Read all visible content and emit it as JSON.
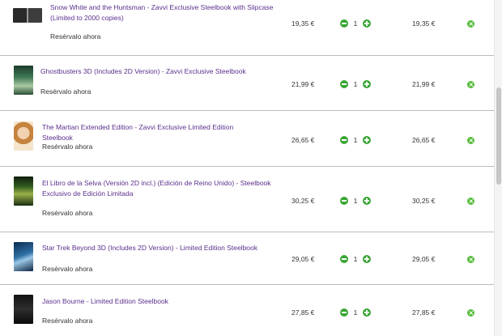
{
  "colors": {
    "title": "#5b2f8c",
    "minus_button": "#3aa635",
    "plus_button": "#3aa635",
    "remove_button": "#55bb3a"
  },
  "icons": {
    "decrease": "minus-circle-icon",
    "increase": "plus-circle-icon",
    "remove": "close-circle-icon"
  },
  "cart": {
    "items": [
      {
        "title": "Snow White and the Huntsman - Zavvi Exclusive Steelbook with Slipcase (Limited to 2000 copies)",
        "status": "Resérvalo ahora",
        "unit_price": "19,35 €",
        "quantity": "1",
        "total": "19,35 €"
      },
      {
        "title": "Ghostbusters 3D (Includes 2D Version) - Zavvi Exclusive Steelbook",
        "status": "Resérvalo ahora",
        "unit_price": "21,99 €",
        "quantity": "1",
        "total": "21,99 €"
      },
      {
        "title": "The Martian Extended Edition - Zavvi Exclusive Limited Edition Steelbook",
        "status": "Resérvalo ahora",
        "unit_price": "26,65 €",
        "quantity": "1",
        "total": "26,65 €"
      },
      {
        "title": "El Libro de la Selva (Versión 2D incl.) (Edición de Reino Unido) - Steelbook Exclusivo de Edición Limitada",
        "status": "Resérvalo ahora",
        "unit_price": "30,25 €",
        "quantity": "1",
        "total": "30,25 €"
      },
      {
        "title": "Star Trek Beyond 3D (Includes 2D Version) - Limited Edition Steelbook",
        "status": "Resérvalo ahora",
        "unit_price": "29,05 €",
        "quantity": "1",
        "total": "29,05 €"
      },
      {
        "title": "Jason Bourne - Limited Edition Steelbook",
        "status": "Resérvalo ahora",
        "unit_price": "27,85 €",
        "quantity": "1",
        "total": "27,85 €"
      }
    ]
  }
}
